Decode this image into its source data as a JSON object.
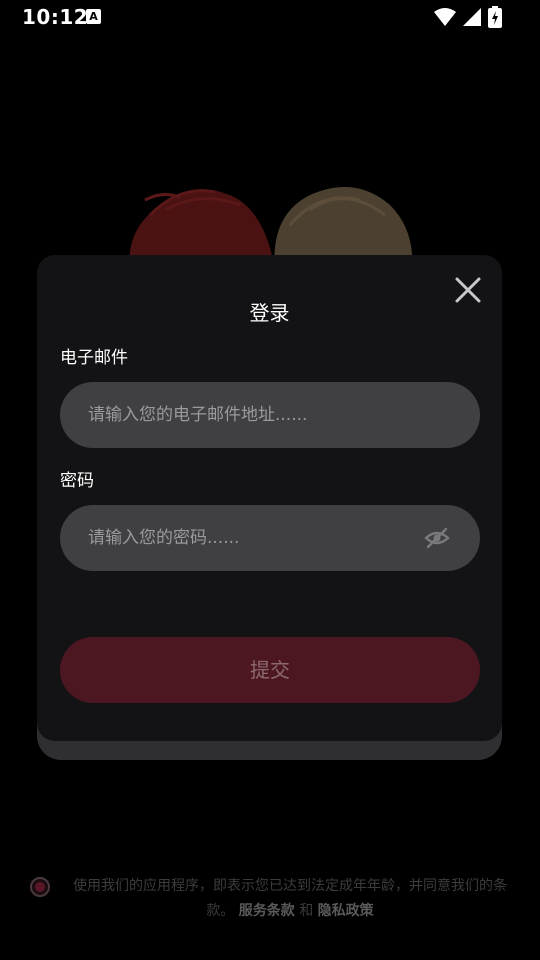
{
  "status_bar": {
    "time": "10:12",
    "notification_glyph": "A",
    "icons": [
      "wifi-icon",
      "signal-icon",
      "battery-charging-icon"
    ]
  },
  "login": {
    "title": "登录",
    "email_label": "电子邮件",
    "email_placeholder": "请输入您的电子邮件地址......",
    "email_value": "",
    "password_label": "密码",
    "password_placeholder": "请输入您的密码......",
    "password_value": "",
    "submit_label": "提交",
    "close_icon": "close-icon",
    "visibility_icon": "eye-off-icon"
  },
  "agreement": {
    "text": "使用我们的应用程序，即表示您已达到法定成年年龄，并同意我们的条款。",
    "terms_link": "服务条款",
    "and": "和",
    "privacy_link": "隐私政策",
    "checked": false
  },
  "colors": {
    "background": "#000000",
    "dialog": "#131315",
    "input": "#404043",
    "submit_disabled": "#4d1722",
    "accent": "#5a1625"
  }
}
